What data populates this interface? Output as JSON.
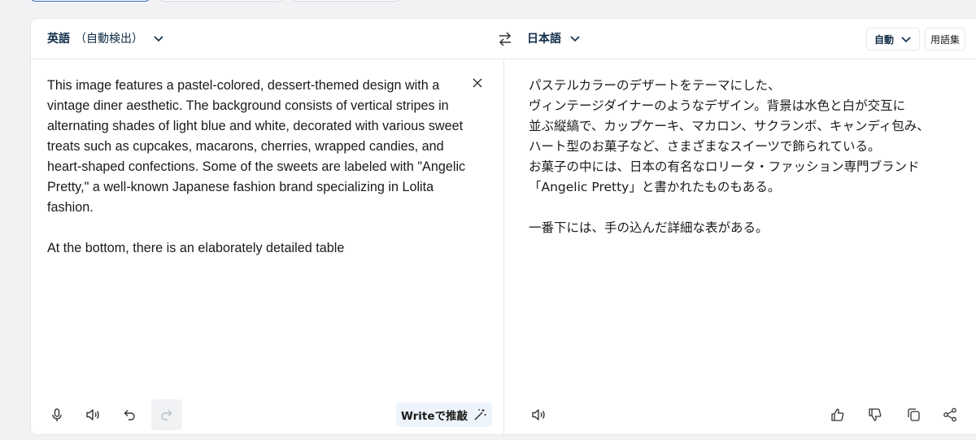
{
  "header": {
    "source_lang": "英語",
    "source_detect": "（自動検出）",
    "target_lang": "日本語",
    "formality": "自動",
    "glossary": "用語集"
  },
  "source": {
    "text": "This image features a pastel-colored, dessert-themed design with a vintage diner aesthetic. The background consists of vertical stripes in alternating shades of light blue and white, decorated with various sweet treats such as cupcakes, macarons, cherries, wrapped candies, and heart-shaped confections. Some of the sweets are labeled with \"Angelic Pretty,\" a well-known Japanese fashion brand specializing in Lolita fashion.\n\nAt the bottom, there is an elaborately detailed table"
  },
  "target": {
    "text": "パステルカラーのデザートをテーマにした、\nヴィンテージダイナーのようなデザイン。背景は水色と白が交互に\n並ぶ縦縞で、カップケーキ、マカロン、サクランボ、キャンディ包み、\nハート型のお菓子など、さまざまなスイーツで飾られている。\nお菓子の中には、日本の有名なロリータ・ファッション専門ブランド\n「Angelic Pretty」と書かれたものもある。\n\n一番下には、手の込んだ詳細な表がある。"
  },
  "toolbar": {
    "write_label": "Writeで推敲"
  },
  "icons": {
    "mic": "microphone-icon",
    "speaker": "speaker-icon",
    "undo": "undo-icon",
    "redo": "redo-icon",
    "clear": "close-icon",
    "swap": "swap-icon",
    "thumbs_up": "thumbs-up-icon",
    "thumbs_down": "thumbs-down-icon",
    "copy": "copy-icon",
    "share": "share-icon",
    "magic": "magic-wand-icon"
  },
  "colors": {
    "accent": "#0f2b46",
    "write_bg": "#eef4fb",
    "page_bg": "#f1f2f4"
  }
}
